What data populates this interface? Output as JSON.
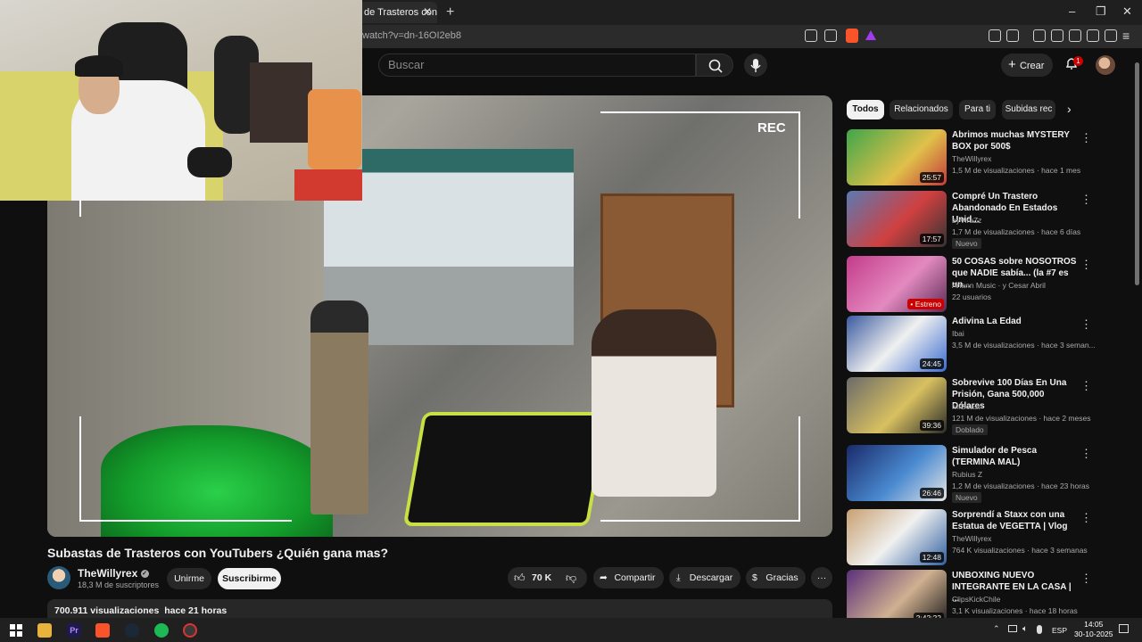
{
  "browser": {
    "tab_title": "de Trasteros con",
    "url": "watch?v=dn-16OI2eb8",
    "window_controls": [
      "–",
      "❐",
      "✕"
    ]
  },
  "header": {
    "search_placeholder": "Buscar",
    "create_label": "Crear",
    "notification_count": "1"
  },
  "video": {
    "overlay_text": "REC",
    "title": "Subastas de Trasteros con YouTubers ¿Quién gana mas?",
    "channel": "TheWillyrex",
    "subscribers": "18,3 M de suscriptores",
    "join_label": "Unirme",
    "subscribe_label": "Suscribirme",
    "likes": "70 K",
    "share_label": "Compartir",
    "download_label": "Descargar",
    "thanks_label": "Gracias",
    "views": "700.911 visualizaciones",
    "published": "hace 21 horas"
  },
  "chips": [
    "Todos",
    "Relacionados",
    "Para ti",
    "Subidas rec"
  ],
  "recommendations": [
    {
      "title": "Abrimos muchas MYSTERY BOX por 500$",
      "channel": "TheWillyrex",
      "meta": "1,5 M de visualizaciones · hace 1 mes",
      "duration": "25:57",
      "badge": ""
    },
    {
      "title": "Compré Un Trastero Abandonado En Estados Unid...",
      "channel": "byViruZz",
      "meta": "1,7 M de visualizaciones · hace 6 días",
      "duration": "17:57",
      "badge": "Nuevo"
    },
    {
      "title": "50 COSAS sobre NOSOTROS que NADIE sabía... (la #7 es un...",
      "channel": "Ariann Music · y Cesar Abril",
      "meta": "22 usuarios",
      "duration": "• Estreno",
      "badge": ""
    },
    {
      "title": "Adivina La Edad",
      "channel": "Ibai",
      "meta": "3,5 M de visualizaciones · hace 3 seman...",
      "duration": "24:45",
      "badge": ""
    },
    {
      "title": "Sobrevive 100 Días En Una Prisión, Gana 500,000 Dólares",
      "channel": "MrBeast",
      "meta": "121 M de visualizaciones · hace 2 meses",
      "duration": "39:36",
      "badge": "Doblado"
    },
    {
      "title": "Simulador de Pesca (TERMINA MAL)",
      "channel": "Rubius Z",
      "meta": "1,2 M de visualizaciones · hace 23 horas",
      "duration": "26:46",
      "badge": "Nuevo"
    },
    {
      "title": "Sorprendí a Staxx con una Estatua de VEGETTA | Vlog",
      "channel": "TheWillyrex",
      "meta": "764 K visualizaciones · hace 3 semanas",
      "duration": "12:48",
      "badge": ""
    },
    {
      "title": "UNBOXING NUEVO INTEGRANTE EN LA CASA | ...",
      "channel": "ClipsKickChile",
      "meta": "3,1 K visualizaciones · hace 18 horas",
      "duration": "2:42:22",
      "badge": ""
    }
  ],
  "taskbar": {
    "language": "ESP",
    "time": "14:05",
    "date": "30-10-2025"
  },
  "colors": {
    "background": "#0f0f0f",
    "accent_red": "#cc0000",
    "chip_active": "#f1f1f1"
  }
}
